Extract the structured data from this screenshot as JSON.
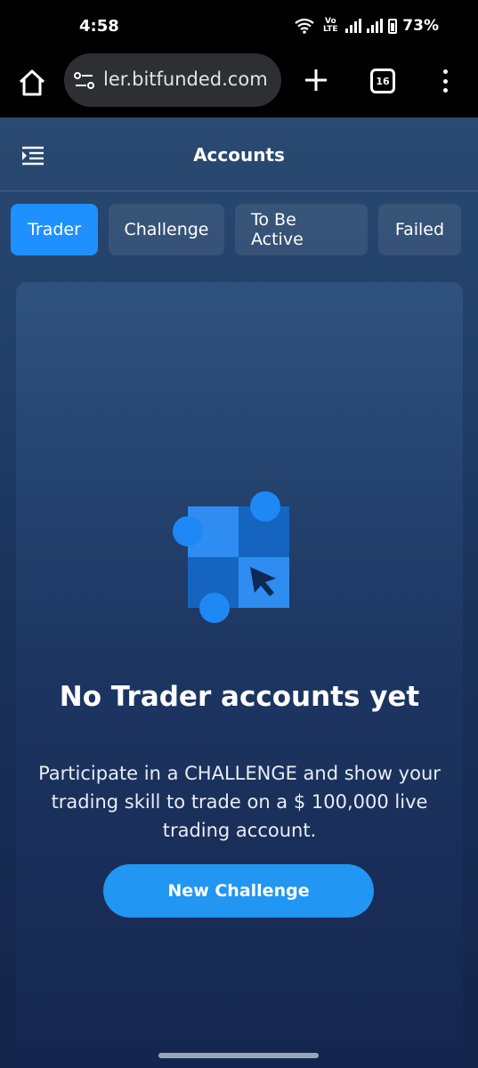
{
  "status_bar": {
    "time": "4:58",
    "volte_top": "Vo",
    "volte_bottom": "LTE",
    "battery": "73%"
  },
  "browser": {
    "url": "ler.bitfunded.com",
    "tab_count": "16"
  },
  "header": {
    "title": "Accounts"
  },
  "tabs": [
    {
      "label": "Trader",
      "active": true
    },
    {
      "label": "Challenge",
      "active": false
    },
    {
      "label": "To Be Active",
      "active": false
    },
    {
      "label": "Failed",
      "active": false
    }
  ],
  "empty_state": {
    "title": "No Trader accounts yet",
    "description": "Participate in a CHALLENGE and show your trading skill to trade on a $ 100,000 live trading account.",
    "button_label": "New Challenge"
  },
  "colors": {
    "accent": "#1e90ff",
    "button": "#2196f3"
  }
}
